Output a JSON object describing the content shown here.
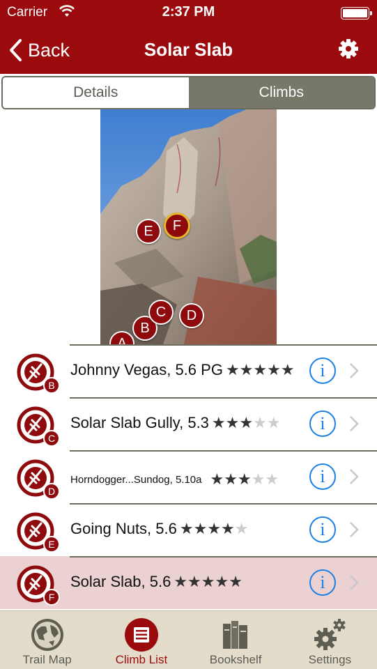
{
  "status_bar": {
    "carrier": "Carrier",
    "time": "2:37 PM"
  },
  "nav": {
    "back_label": "Back",
    "title": "Solar Slab"
  },
  "segments": {
    "details": "Details",
    "climbs": "Climbs",
    "selected": "Climbs"
  },
  "photo": {
    "markers": [
      "A",
      "B",
      "C",
      "D",
      "E",
      "F"
    ],
    "selected_marker": "F"
  },
  "climbs": [
    {
      "name": "Johnny Vegas, 5.6 PG",
      "letter": "B",
      "stars": "★★★★★",
      "stars_empty": "",
      "rating": 5,
      "selected": false,
      "small": false
    },
    {
      "name": "Solar Slab Gully, 5.3",
      "letter": "C",
      "stars": "★★★",
      "stars_empty": "★★",
      "rating": 3,
      "selected": false,
      "small": false
    },
    {
      "name": "Horndogger...Sundog, 5.10a",
      "letter": "D",
      "stars": "★★★",
      "stars_empty": "★★",
      "rating": 3,
      "selected": false,
      "small": true
    },
    {
      "name": "Going Nuts, 5.6",
      "letter": "E",
      "stars": "★★★★",
      "stars_empty": "★",
      "rating": 4,
      "selected": false,
      "small": false
    },
    {
      "name": "Solar Slab, 5.6",
      "letter": "F",
      "stars": "★★★★★",
      "stars_empty": "",
      "rating": 5,
      "selected": true,
      "small": false
    }
  ],
  "tabs": [
    {
      "label": "Trail Map",
      "icon": "globe-icon",
      "active": false
    },
    {
      "label": "Climb List",
      "icon": "list-icon",
      "active": true
    },
    {
      "label": "Bookshelf",
      "icon": "books-icon",
      "active": false
    },
    {
      "label": "Settings",
      "icon": "gears-icon",
      "active": false
    }
  ],
  "colors": {
    "brand": "#9b0a0d",
    "selected_row": "#ecd1d2",
    "info_blue": "#1a7fe6",
    "tabbar": "#e3dccb"
  }
}
